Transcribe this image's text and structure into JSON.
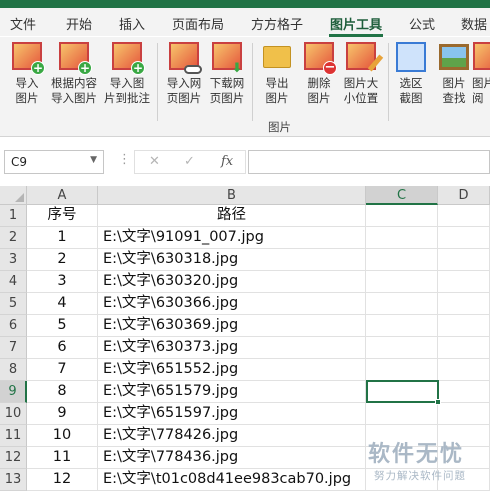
{
  "menu_tabs": [
    "文件",
    "开始",
    "插入",
    "页面布局",
    "方方格子",
    "图片工具",
    "公式",
    "数据"
  ],
  "active_tab": "图片工具",
  "ribbon": {
    "buttons": [
      {
        "line1": "导入",
        "line2": "图片",
        "icon": "import-image-icon"
      },
      {
        "line1": "根据内容",
        "line2": "导入图片",
        "icon": "import-by-content-icon"
      },
      {
        "line1": "导入图",
        "line2": "片到批注",
        "icon": "import-to-comment-icon"
      },
      {
        "line1": "导入网",
        "line2": "页图片",
        "icon": "import-web-image-icon"
      },
      {
        "line1": "下载网",
        "line2": "页图片",
        "icon": "download-web-image-icon"
      },
      {
        "line1": "导出",
        "line2": "图片",
        "icon": "export-image-icon"
      },
      {
        "line1": "删除",
        "line2": "图片",
        "icon": "delete-image-icon"
      },
      {
        "line1": "图片大",
        "line2": "小位置",
        "icon": "image-size-position-icon"
      },
      {
        "line1": "选区",
        "line2": "截图",
        "icon": "selection-screenshot-icon"
      },
      {
        "line1": "图片",
        "line2": "查找",
        "icon": "image-find-icon"
      },
      {
        "line1": "图片",
        "line2": "阅",
        "icon": "image-view-icon"
      }
    ],
    "group_label": "图片"
  },
  "formula_bar": {
    "name_box": "C9",
    "cancel_symbol": "✕",
    "enter_symbol": "✓",
    "fx_label": "fx",
    "formula": ""
  },
  "columns": [
    "A",
    "B",
    "C",
    "D"
  ],
  "selected_column": "C",
  "selected_row": "9",
  "rows": [
    {
      "n": "1",
      "a": "序号",
      "b": "路径",
      "b_center": true
    },
    {
      "n": "2",
      "a": "1",
      "b": "E:\\文字\\91091_007.jpg"
    },
    {
      "n": "3",
      "a": "2",
      "b": "E:\\文字\\630318.jpg"
    },
    {
      "n": "4",
      "a": "3",
      "b": "E:\\文字\\630320.jpg"
    },
    {
      "n": "5",
      "a": "4",
      "b": "E:\\文字\\630366.jpg"
    },
    {
      "n": "6",
      "a": "5",
      "b": "E:\\文字\\630369.jpg"
    },
    {
      "n": "7",
      "a": "6",
      "b": "E:\\文字\\630373.jpg"
    },
    {
      "n": "8",
      "a": "7",
      "b": "E:\\文字\\651552.jpg"
    },
    {
      "n": "9",
      "a": "8",
      "b": "E:\\文字\\651579.jpg"
    },
    {
      "n": "10",
      "a": "9",
      "b": "E:\\文字\\651597.jpg"
    },
    {
      "n": "11",
      "a": "10",
      "b": "E:\\文字\\778426.jpg"
    },
    {
      "n": "12",
      "a": "11",
      "b": "E:\\文字\\778436.jpg"
    },
    {
      "n": "13",
      "a": "12",
      "b": "E:\\文字\\t01c08d41ee983cab70.jpg"
    }
  ],
  "watermark": {
    "main": "软件无忧",
    "sub": "努力解决软件问题"
  },
  "colors": {
    "accent": "#217346"
  }
}
